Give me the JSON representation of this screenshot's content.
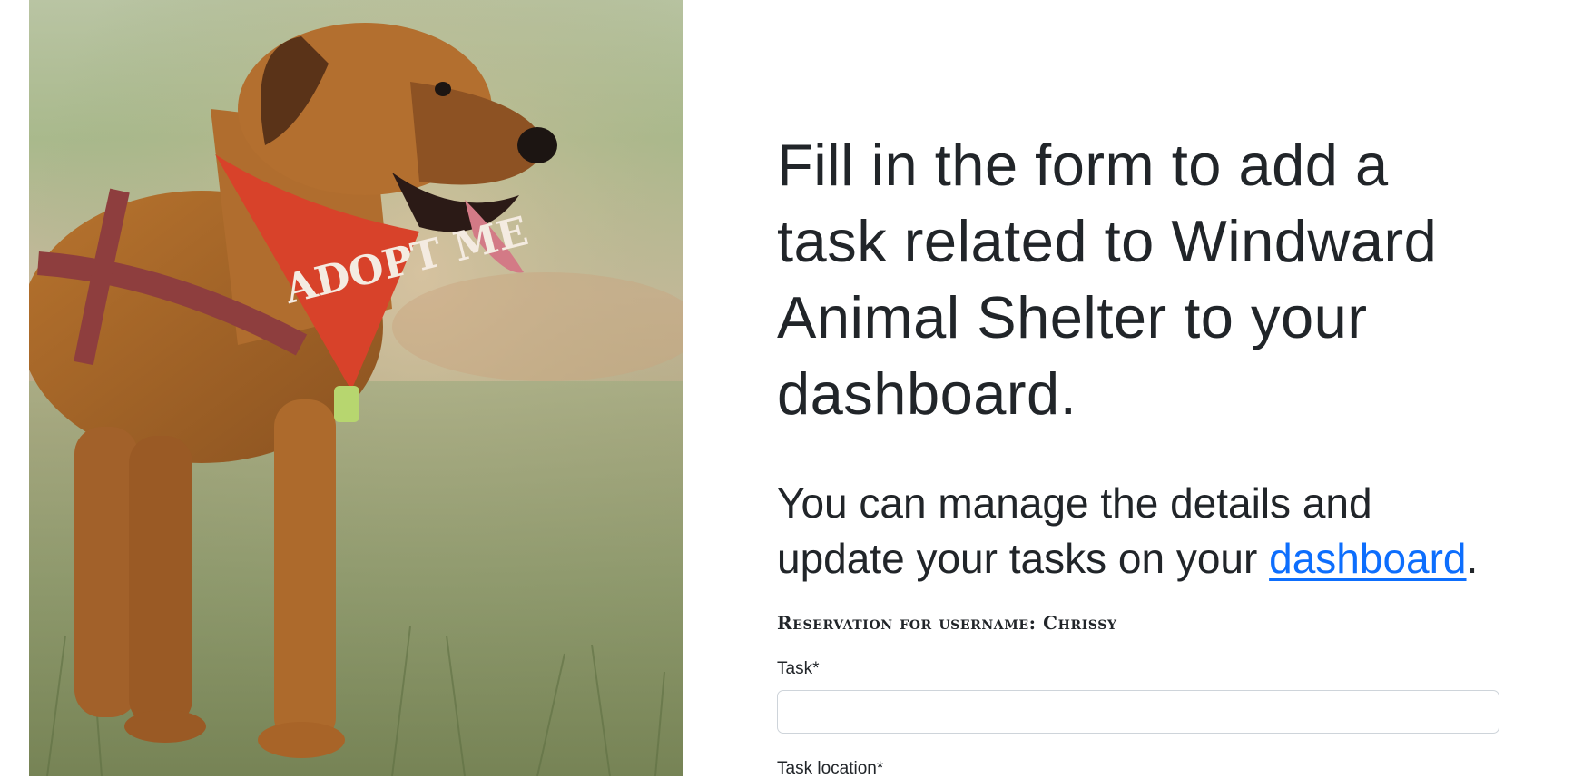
{
  "image": {
    "alt": "",
    "bandana_text": "ADOPT ME"
  },
  "form_intro": {
    "headline": "Fill in the form to add a task related to Windward Animal Shelter to your dashboard.",
    "lead_before_link": "You can manage the details and update your tasks on your ",
    "dashboard_link": "dashboard",
    "lead_after_link": "."
  },
  "reservation": {
    "label": "Reservation for username: Chrissy"
  },
  "fields": {
    "task": {
      "label": "Task*",
      "value": "",
      "placeholder": ""
    },
    "task_location": {
      "label": "Task location*"
    }
  },
  "colors": {
    "link": "#0d6efd",
    "text": "#212529",
    "input_border": "#ced4da"
  }
}
